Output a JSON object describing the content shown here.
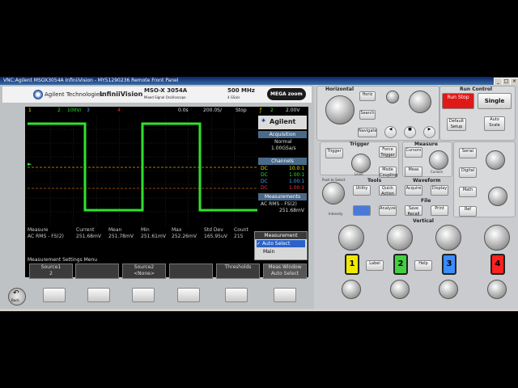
{
  "window": {
    "title": "VNC:Agilent MSOX3054A InfiniiVision - MY51290236 Remote Front Panel"
  },
  "header": {
    "brand": "Agilent Technologies",
    "series": "InfiniiVision",
    "model": "MSO-X 3054A",
    "model_sub": "Mixed Signal Oscilloscope",
    "bandwidth": "500 MHz",
    "sample_rate": "4 GSa/s",
    "megazoom": "MEGA zoom"
  },
  "status_bar": {
    "ch1": "1",
    "ch1_scale": "2",
    "ch2_scale": "100V/",
    "ch3": "3",
    "ch4": "4",
    "delay": "0.0s",
    "timebase": "200.0S/",
    "run_state": "Stop",
    "trig_ch": "2",
    "trig_level": "2.00V"
  },
  "side_panel": {
    "logo": "Agilent",
    "acquisition_title": "Acquisition",
    "acq_mode": "Normal",
    "acq_rate": "1.00GSa/s",
    "channels_title": "Channels",
    "channels": [
      {
        "coupling": "DC",
        "value": "10.0:1",
        "color": "#e8e000"
      },
      {
        "coupling": "DC",
        "value": "1.00:1",
        "color": "#30e030"
      },
      {
        "coupling": "DC",
        "value": "1.00:1",
        "color": "#4aa0ff"
      },
      {
        "coupling": "DC",
        "value": "1.00:1",
        "color": "#ff3030"
      }
    ],
    "measurements_title": "Measurements",
    "meas_name": "AC RMS - FS(2)",
    "meas_value": "251.68mV"
  },
  "measurement_table": {
    "headers": [
      "Measure",
      "Current",
      "Mean",
      "Min",
      "Max",
      "Std Dev",
      "Count"
    ],
    "row": [
      "AC RMS - FS(2)",
      "251.68mV",
      "251.78mV",
      "251.61mV",
      "252.26mV",
      "165.95uV",
      "215"
    ]
  },
  "popup": {
    "title": "Measurement Window",
    "items": [
      "Auto Select",
      "Main"
    ],
    "selected": "Auto Select"
  },
  "softkeys": {
    "menu_title": "Measurement Settings Menu",
    "keys": [
      {
        "label": "Source1",
        "value": "2"
      },
      {
        "label": "",
        "value": ""
      },
      {
        "label": "Source2",
        "value": "<None>"
      },
      {
        "label": "",
        "value": ""
      },
      {
        "label": "Thresholds",
        "value": ""
      },
      {
        "label": "Meas Window",
        "value": "Auto Select"
      }
    ]
  },
  "back_button": {
    "label": "Back"
  },
  "panel": {
    "horizontal_title": "Horizontal",
    "run_control_title": "Run Control",
    "run_stop": "Run Stop",
    "single": "Single",
    "horiz": "Horiz",
    "search": "Search",
    "navigate": "Navigate",
    "default_setup": "Default Setup",
    "auto_scale": "Auto Scale",
    "trigger_title": "Trigger",
    "trigger": "Trigger",
    "force_trigger": "Force Trigger",
    "mode_coupling": "Mode Coupling",
    "level": "Level",
    "measure_title": "Measure",
    "cursors_btn": "Cursors",
    "meas_btn": "Meas",
    "cursors_label": "Cursors",
    "tools_title": "Tools",
    "utility": "Utility",
    "quick_action": "Quick Action",
    "waveform_title": "Waveform",
    "acquire": "Acquire",
    "display": "Display",
    "file_title": "File",
    "analyze": "Analyze",
    "save_recall": "Save Recall",
    "print": "Print",
    "push_to_select": "Push to Select",
    "intensity": "Intensity",
    "serial": "Serial",
    "digital": "Digital",
    "math": "Math",
    "ref": "Ref",
    "vertical_title": "Vertical",
    "label_btn": "Label",
    "help_btn": "Help",
    "ch_buttons": [
      {
        "num": "1",
        "color": "#f0e800"
      },
      {
        "num": "2",
        "color": "#40d040"
      },
      {
        "num": "3",
        "color": "#3a8cff"
      },
      {
        "num": "4",
        "color": "#ff2020"
      }
    ]
  },
  "chart_data": {
    "type": "line",
    "series": [
      {
        "values": [
          1,
          1,
          0,
          0,
          1,
          1,
          0,
          0
        ],
        "color": "#30e030"
      }
    ]
  }
}
